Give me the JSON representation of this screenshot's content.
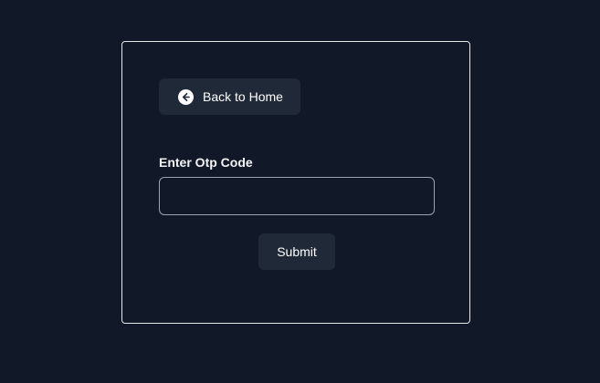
{
  "back_button": {
    "label": "Back to Home",
    "icon": "arrow-left-circle-icon"
  },
  "otp_form": {
    "label": "Enter Otp Code",
    "input_value": "",
    "input_placeholder": "",
    "submit_label": "Submit"
  },
  "colors": {
    "background": "#111827",
    "button_bg": "#1f2937",
    "card_border": "#e5e7eb",
    "input_border": "#9ca3af",
    "text": "#ffffff"
  }
}
